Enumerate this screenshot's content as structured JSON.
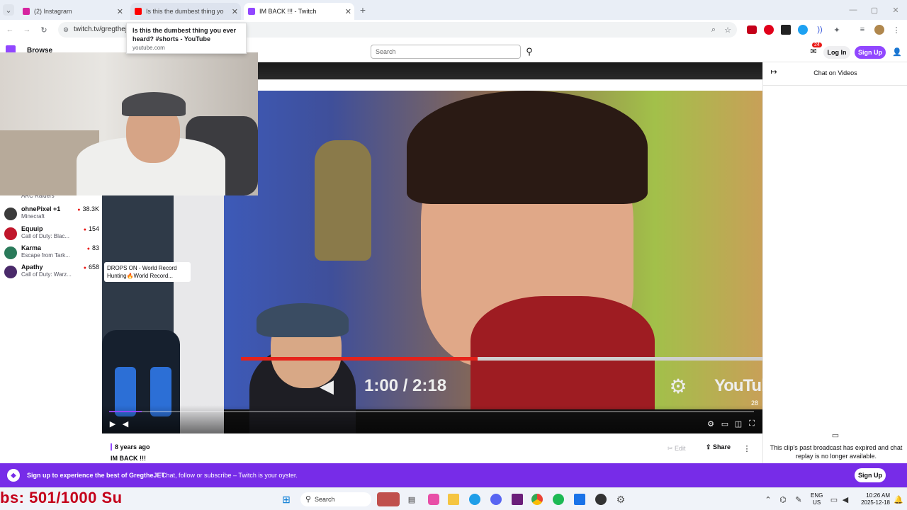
{
  "browser": {
    "tabs": [
      {
        "title": "(2) Instagram",
        "favicon_color": "#d6249f"
      },
      {
        "title": "Is this the dumbest thing you e",
        "favicon_color": "#ff0000"
      },
      {
        "title": "IM BACK !!! - Twitch",
        "favicon_color": "#9147ff"
      }
    ],
    "new_tab": "+",
    "url": "twitch.tv/gregthej",
    "tooltip": {
      "title": "Is this the dumbest thing you ever heard? #shorts - YouTube",
      "host": "youtube.com"
    }
  },
  "twitch": {
    "browse": "Browse",
    "search_placeholder": "Search",
    "notifications_count": "24",
    "login": "Log In",
    "signup": "Sign Up"
  },
  "sidebar": {
    "channels": [
      {
        "game": "ARC Raiders",
        "avatar_color": "#555"
      },
      {
        "name": "ohnePixel +1",
        "game": "Minecraft",
        "viewers": "38.3K",
        "avatar_color": "#3b3b3b"
      },
      {
        "name": "Equuip",
        "game": "Call of Duty: Blac...",
        "viewers": "154",
        "avatar_color": "#c0162b"
      },
      {
        "name": "Karma",
        "game": "Escape from Tark...",
        "viewers": "83",
        "avatar_color": "#2a7a5a"
      },
      {
        "name": "Apathy",
        "game": "Call of Duty: Warz...",
        "viewers": "658",
        "avatar_color": "#4a2a6a"
      }
    ]
  },
  "video": {
    "overlay_card": "DROPS ON - World Record Hunting🔥World Record...",
    "embedded_time": "1:00 / 2:18",
    "embedded_logo": "YouTube",
    "viewer_badge": "28",
    "progress": 0.05
  },
  "below_video": {
    "age": "8 years ago",
    "title": "IM BACK !!!",
    "edit": "Edit",
    "share": "Share"
  },
  "chat": {
    "header": "Chat on Videos",
    "expired_message": "This clip's past broadcast has expired and chat replay is no longer available."
  },
  "banner": {
    "text_bold": "Sign up to experience the best of GregtheJET",
    "text": "Chat, follow or subscribe – Twitch is your oyster.",
    "button": "Sign Up"
  },
  "taskbar": {
    "search": "Search",
    "lang": "ENG",
    "region": "US",
    "time": "10:26 AM",
    "date": "2025-12-18"
  },
  "overlay_text": "bs: 501/1000 Su"
}
